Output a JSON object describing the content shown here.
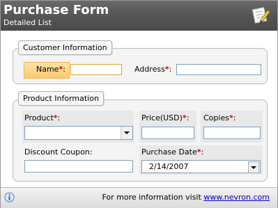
{
  "header": {
    "title": "Purchase Form",
    "subtitle": "Detailed List"
  },
  "customer": {
    "group_title": "Customer Information",
    "name_label": "Name",
    "name_value": "",
    "address_label": "Address",
    "address_value": ""
  },
  "product": {
    "group_title": "Product Information",
    "product_label": "Product",
    "product_value": "",
    "price_label": "Price(USD)",
    "price_value": "",
    "copies_label": "Copies",
    "copies_value": "",
    "coupon_label": "Discount Coupon:",
    "coupon_value": "",
    "date_label": "Purchase Date",
    "date_value": "2/14/2007"
  },
  "required_mark": "*",
  "footer": {
    "info_text": "For more information visit",
    "link_text": "www.nevron.com"
  },
  "colors": {
    "header_bg": "#565656",
    "focus_label_bg": "#ffc96b",
    "required": "#e00000",
    "link": "#0000cc"
  },
  "icons": [
    "form-edit-icon",
    "info-icon",
    "dropdown-arrow-icon"
  ]
}
